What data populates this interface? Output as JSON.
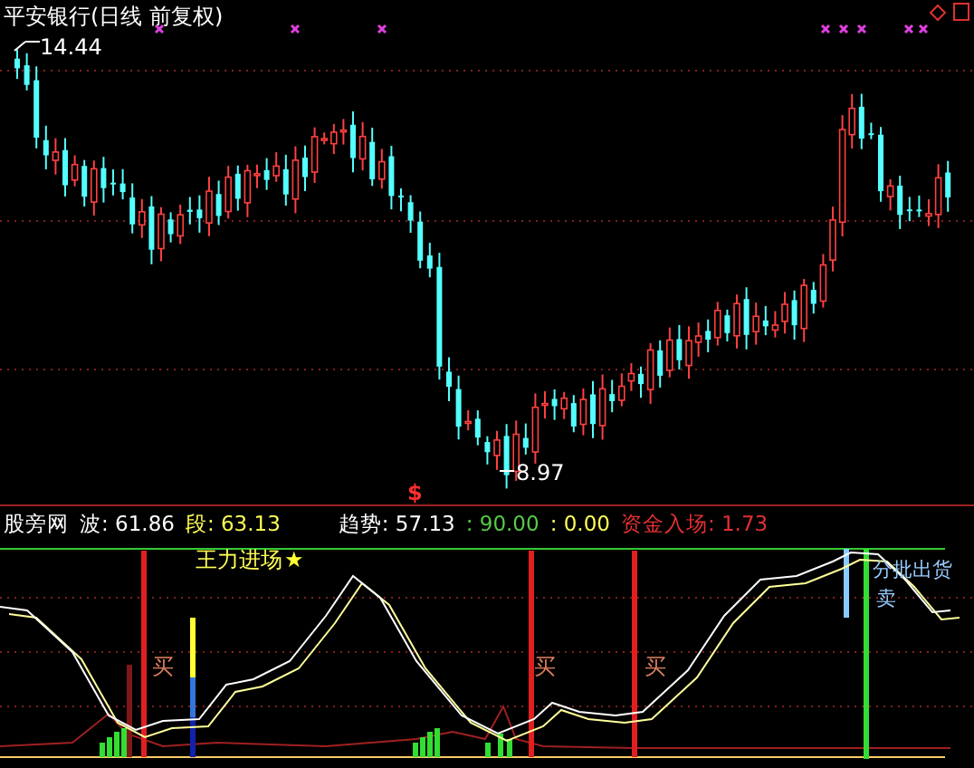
{
  "chart": {
    "title": "平安银行(日线 前复权)",
    "high_label": "14.44",
    "low_label": "8.97",
    "signal_mark": "$"
  },
  "indicator": {
    "name": "股旁网",
    "values": [
      {
        "text": "波: 61.86",
        "color": "#ffffff"
      },
      {
        "text": "段: 63.13",
        "color": "#ffff55"
      },
      {
        "text": "趋势: 57.13",
        "color": "#ffffff"
      },
      {
        "text": ": 90.00",
        "color": "#55cc44"
      },
      {
        "text": ": 0.00",
        "color": "#ffff55"
      },
      {
        "text": "资金入场: 1.73",
        "color": "#e03030"
      }
    ]
  },
  "lower_panel": {
    "entry_label": "王力进场",
    "entry_star": "★",
    "buy_labels": [
      "买",
      "买",
      "买"
    ],
    "sell_label": "分批出货",
    "sell_sub": "卖"
  }
}
